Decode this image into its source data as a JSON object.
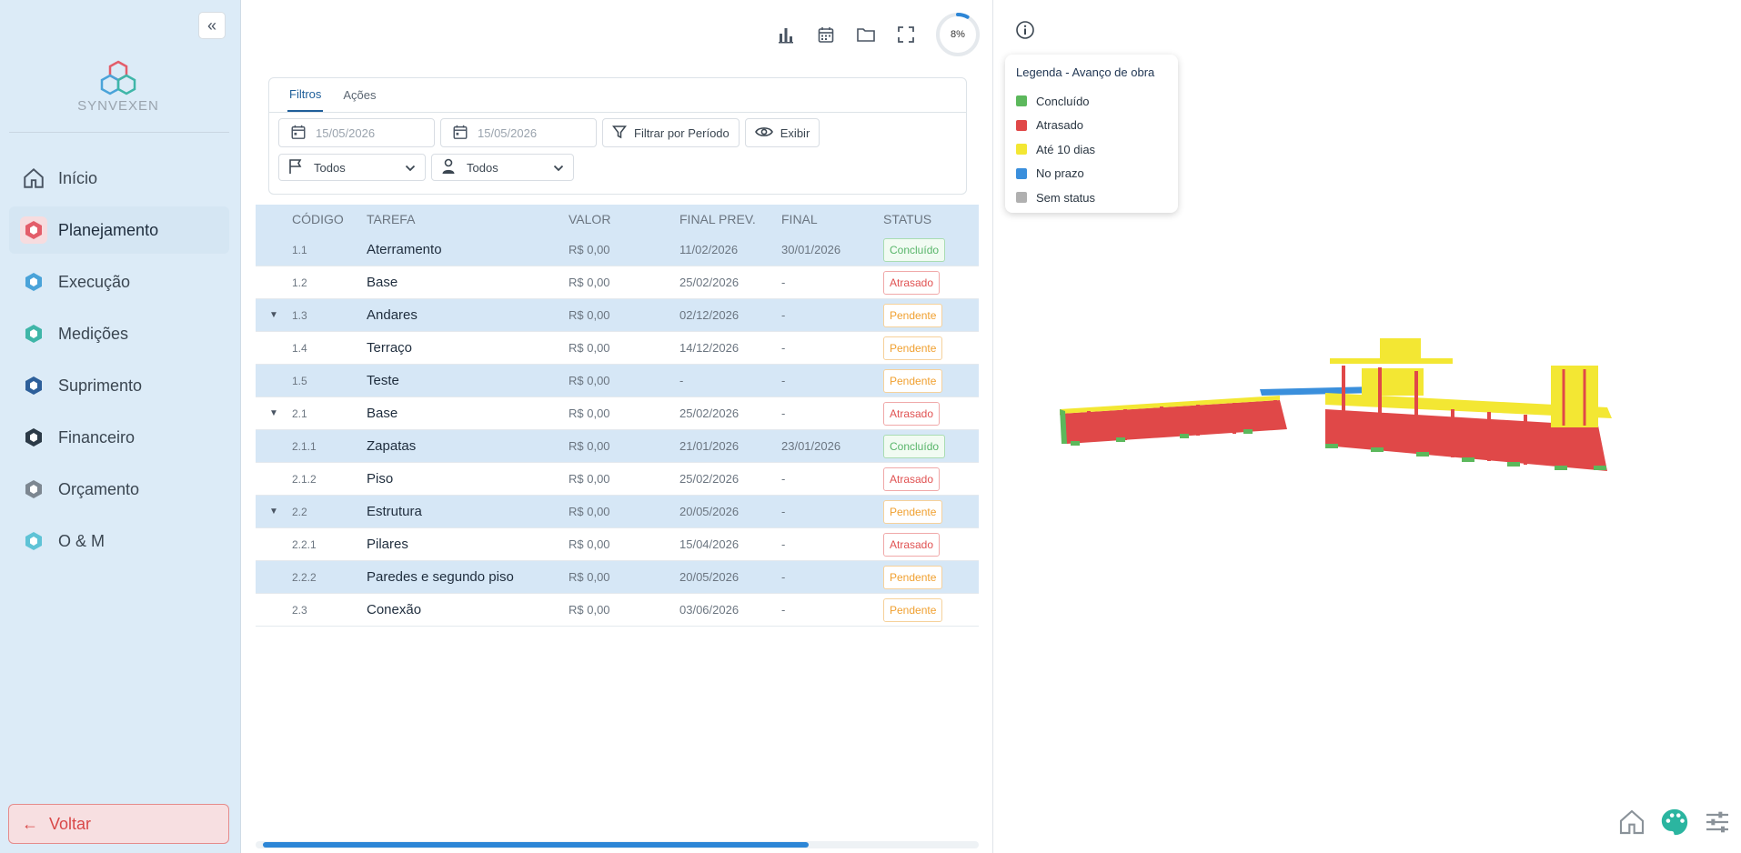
{
  "sidebar": {
    "logo_text": "SYNVEXEN",
    "items": [
      {
        "label": "Início",
        "icon": "home-icon"
      },
      {
        "label": "Planejamento",
        "icon": "planning-icon"
      },
      {
        "label": "Execução",
        "icon": "execution-icon"
      },
      {
        "label": "Medições",
        "icon": "measurements-icon"
      },
      {
        "label": "Suprimento",
        "icon": "supply-icon"
      },
      {
        "label": "Financeiro",
        "icon": "finance-icon"
      },
      {
        "label": "Orçamento",
        "icon": "budget-icon"
      },
      {
        "label": "O & M",
        "icon": "om-icon"
      }
    ],
    "back_label": "Voltar"
  },
  "toolbar": {
    "progress_label": "8%",
    "progress": 0.08
  },
  "filters": {
    "tabs": [
      {
        "label": "Filtros"
      },
      {
        "label": "Ações"
      }
    ],
    "date_start_placeholder": "15/05/2026",
    "date_end_placeholder": "15/05/2026",
    "filter_period_label": "Filtrar por Período",
    "show_label": "Exibir",
    "flag_select_value": "Todos",
    "person_select_value": "Todos"
  },
  "table": {
    "headers": {
      "code": "CÓDIGO",
      "task": "TAREFA",
      "value": "VALOR",
      "final_prev": "FINAL PREV.",
      "final": "FINAL",
      "status": "STATUS"
    },
    "rows": [
      {
        "code": "1.1",
        "task": "Aterramento",
        "value": "R$ 0,00",
        "final_prev": "11/02/2026",
        "final": "30/01/2026",
        "status": "Concluído"
      },
      {
        "code": "1.2",
        "task": "Base",
        "value": "R$ 0,00",
        "final_prev": "25/02/2026",
        "final": "-",
        "status": "Atrasado"
      },
      {
        "code": "1.3",
        "task": "Andares",
        "value": "R$ 0,00",
        "final_prev": "02/12/2026",
        "final": "-",
        "status": "Pendente"
      },
      {
        "code": "1.4",
        "task": "Terraço",
        "value": "R$ 0,00",
        "final_prev": "14/12/2026",
        "final": "-",
        "status": "Pendente"
      },
      {
        "code": "1.5",
        "task": "Teste",
        "value": "R$ 0,00",
        "final_prev": "-",
        "final": "-",
        "status": "Pendente"
      },
      {
        "code": "2.1",
        "task": "Base",
        "value": "R$ 0,00",
        "final_prev": "25/02/2026",
        "final": "-",
        "status": "Atrasado"
      },
      {
        "code": "2.1.1",
        "task": "Zapatas",
        "value": "R$ 0,00",
        "final_prev": "21/01/2026",
        "final": "23/01/2026",
        "status": "Concluído"
      },
      {
        "code": "2.1.2",
        "task": "Piso",
        "value": "R$ 0,00",
        "final_prev": "25/02/2026",
        "final": "-",
        "status": "Atrasado"
      },
      {
        "code": "2.2",
        "task": "Estrutura",
        "value": "R$ 0,00",
        "final_prev": "20/05/2026",
        "final": "-",
        "status": "Pendente"
      },
      {
        "code": "2.2.1",
        "task": "Pilares",
        "value": "R$ 0,00",
        "final_prev": "15/04/2026",
        "final": "-",
        "status": "Atrasado"
      },
      {
        "code": "2.2.2",
        "task": "Paredes e segundo piso",
        "value": "R$ 0,00",
        "final_prev": "20/05/2026",
        "final": "-",
        "status": "Pendente"
      },
      {
        "code": "2.3",
        "task": "Conexão",
        "value": "R$ 0,00",
        "final_prev": "03/06/2026",
        "final": "-",
        "status": "Pendente"
      }
    ]
  },
  "legend": {
    "title": "Legenda - Avanço de obra",
    "items": [
      {
        "label": "Concluído",
        "color": "#5cb85c"
      },
      {
        "label": "Atrasado",
        "color": "#e04848"
      },
      {
        "label": "Até 10 dias",
        "color": "#f3e733"
      },
      {
        "label": "No prazo",
        "color": "#3a8fdc"
      },
      {
        "label": "Sem status",
        "color": "#b0b0b0"
      }
    ]
  }
}
